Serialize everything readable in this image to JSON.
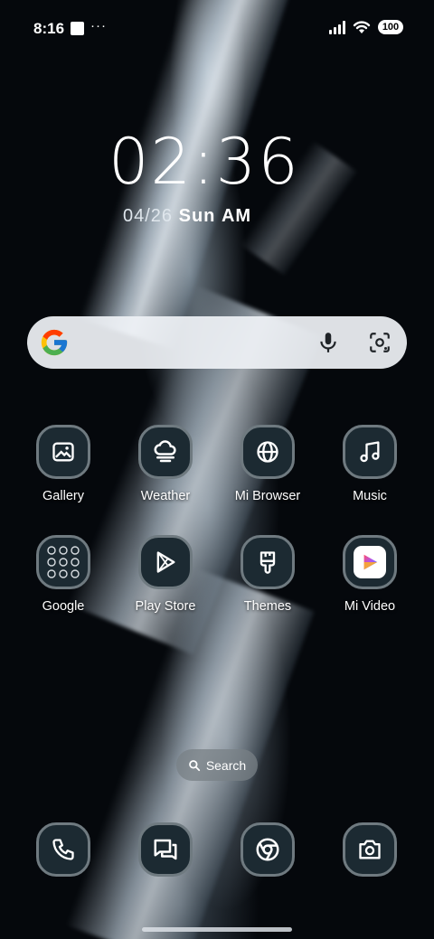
{
  "status_bar": {
    "time": "8:16",
    "more": "···",
    "battery": "100"
  },
  "clock": {
    "time": "02:36",
    "date": "04/26",
    "weekday": "Sun",
    "ampm": "AM"
  },
  "search_bar": {
    "mic_icon": "mic-icon",
    "lens_icon": "google-lens-icon"
  },
  "apps": [
    {
      "label": "Gallery",
      "icon": "gallery-icon"
    },
    {
      "label": "Weather",
      "icon": "weather-icon"
    },
    {
      "label": "Mi Browser",
      "icon": "globe-icon"
    },
    {
      "label": "Music",
      "icon": "music-note-icon"
    },
    {
      "label": "Google",
      "icon": "google-folder-icon"
    },
    {
      "label": "Play Store",
      "icon": "play-store-icon"
    },
    {
      "label": "Themes",
      "icon": "brush-icon"
    },
    {
      "label": "Mi Video",
      "icon": "mi-video-icon"
    }
  ],
  "dock_search": {
    "label": "Search"
  },
  "dock": [
    {
      "icon": "phone-icon"
    },
    {
      "icon": "messages-icon"
    },
    {
      "icon": "chrome-icon"
    },
    {
      "icon": "camera-icon"
    }
  ],
  "colors": {
    "icon_bg": "#1c2a32",
    "icon_ring": "#6f7a80",
    "search_bg": "#eef1f5"
  }
}
